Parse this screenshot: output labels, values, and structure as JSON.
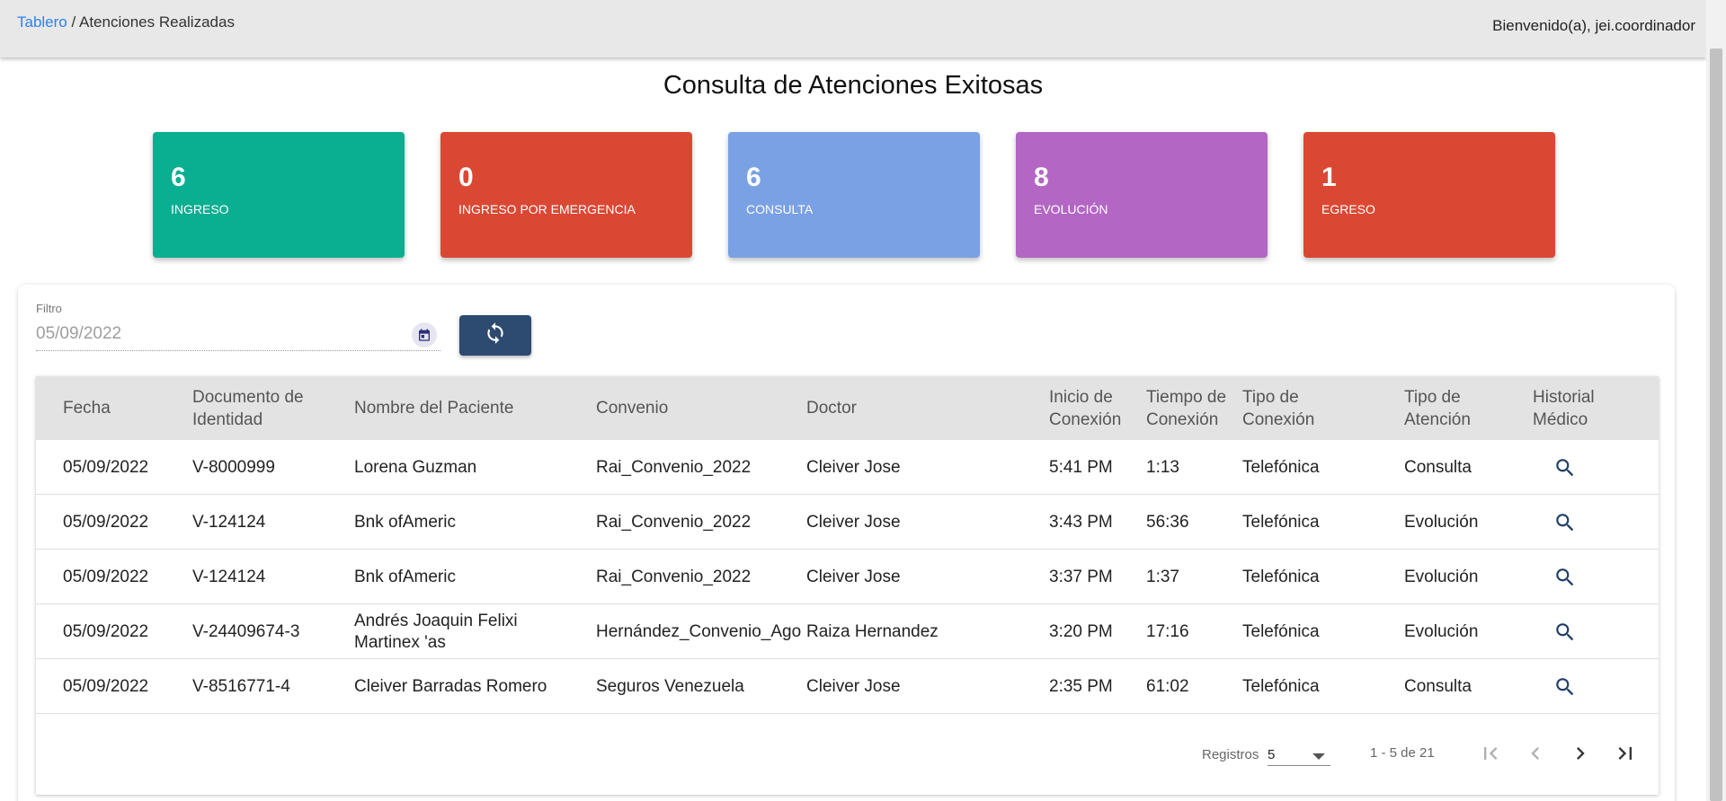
{
  "header": {
    "breadcrumb_link": "Tablero",
    "breadcrumb_sep": " / ",
    "breadcrumb_current": "Atenciones Realizadas",
    "welcome": "Bienvenido(a), jei.coordinador"
  },
  "page_title": "Consulta de Atenciones Exitosas",
  "cards": [
    {
      "value": "6",
      "label": "INGRESO",
      "color": "#0aae91"
    },
    {
      "value": "0",
      "label": "INGRESO POR EMERGENCIA",
      "color": "#da4834"
    },
    {
      "value": "6",
      "label": "CONSULTA",
      "color": "#7aa1e4"
    },
    {
      "value": "8",
      "label": "EVOLUCIÓN",
      "color": "#b366c4"
    },
    {
      "value": "1",
      "label": "EGRESO",
      "color": "#da4834"
    }
  ],
  "filter": {
    "label": "Filtro",
    "value": "05/09/2022"
  },
  "table": {
    "headers": {
      "fecha": "Fecha",
      "documento": "Documento de Identidad",
      "nombre": "Nombre del Paciente",
      "convenio": "Convenio",
      "doctor": "Doctor",
      "inicio": "Inicio de Conexión",
      "tiempo": "Tiempo de Conexión",
      "tipo_conexion": "Tipo de Conexión",
      "tipo_atencion": "Tipo de Atención",
      "historial": "Historial Médico"
    },
    "rows": [
      {
        "fecha": "05/09/2022",
        "documento": "V-8000999",
        "nombre": "Lorena Guzman",
        "convenio": "Rai_Convenio_2022",
        "doctor": "Cleiver Jose",
        "inicio": "5:41 PM",
        "tiempo": "1:13",
        "tipo_conexion": "Telefónica",
        "tipo_atencion": "Consulta"
      },
      {
        "fecha": "05/09/2022",
        "documento": "V-124124",
        "nombre": "Bnk ofAmeric",
        "convenio": "Rai_Convenio_2022",
        "doctor": "Cleiver Jose",
        "inicio": "3:43 PM",
        "tiempo": "56:36",
        "tipo_conexion": "Telefónica",
        "tipo_atencion": "Evolución"
      },
      {
        "fecha": "05/09/2022",
        "documento": "V-124124",
        "nombre": "Bnk ofAmeric",
        "convenio": "Rai_Convenio_2022",
        "doctor": "Cleiver Jose",
        "inicio": "3:37 PM",
        "tiempo": "1:37",
        "tipo_conexion": "Telefónica",
        "tipo_atencion": "Evolución"
      },
      {
        "fecha": "05/09/2022",
        "documento": "V-24409674-3",
        "nombre": "Andrés Joaquin Felixi Martinex 'as",
        "convenio": "Hernández_Convenio_Ago",
        "doctor": "Raiza Hernandez",
        "inicio": "3:20 PM",
        "tiempo": "17:16",
        "tipo_conexion": "Telefónica",
        "tipo_atencion": "Evolución"
      },
      {
        "fecha": "05/09/2022",
        "documento": "V-8516771-4",
        "nombre": "Cleiver Barradas Romero",
        "convenio": "Seguros Venezuela",
        "doctor": "Cleiver Jose",
        "inicio": "2:35 PM",
        "tiempo": "61:02",
        "tipo_conexion": "Telefónica",
        "tipo_atencion": "Consulta"
      }
    ]
  },
  "pagination": {
    "label": "Registros",
    "page_size": "5",
    "range": "1 - 5 de 21"
  },
  "icons": {
    "calendar": "calendar-icon",
    "refresh": "refresh-icon",
    "search": "search-icon",
    "first": "first-page-icon",
    "prev": "prev-page-icon",
    "next": "next-page-icon",
    "last": "last-page-icon"
  }
}
